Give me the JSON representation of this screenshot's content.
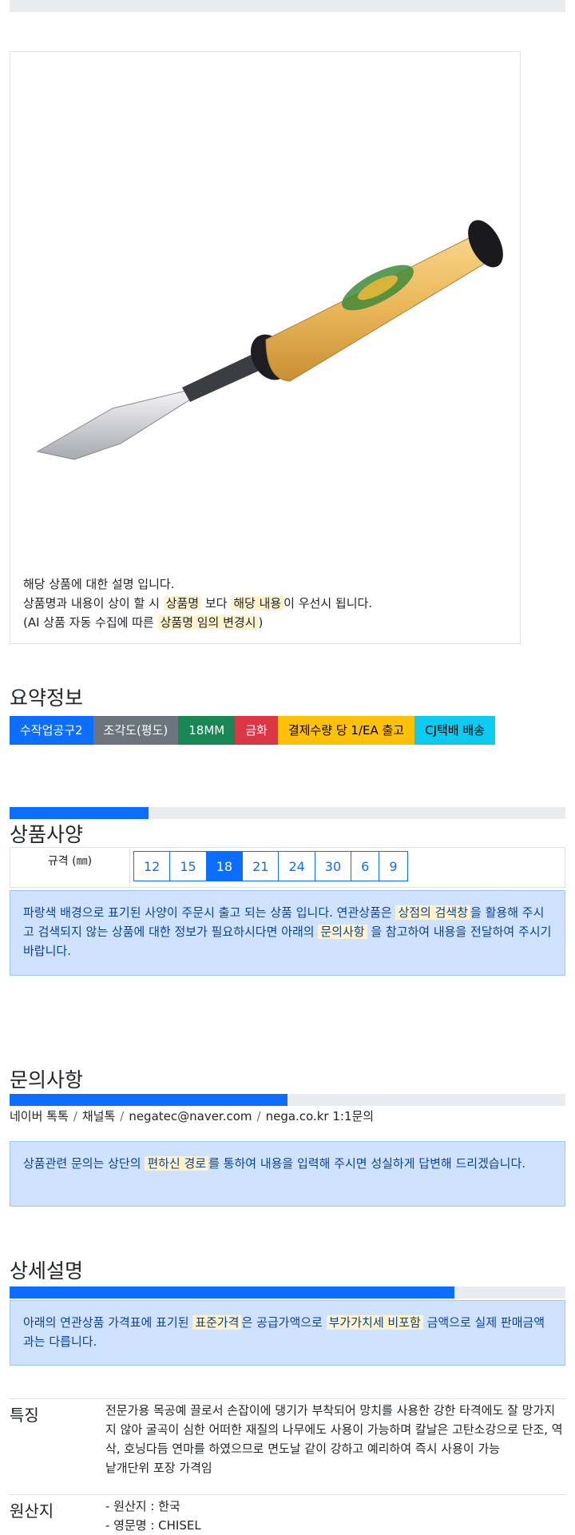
{
  "colors": {
    "primary": "#0d6efd",
    "secondary": "#6c757d",
    "success": "#198754",
    "danger": "#dc3545",
    "warning": "#ffc107",
    "info": "#0dcaf0",
    "highlight": "#fff3cd",
    "alert_bg": "#cfe2ff"
  },
  "product_image": {
    "icon": "chisel-image"
  },
  "description": {
    "line1": "해당 상품에 대한 설명 입니다.",
    "line2_a": "상품명과 내용이 상이 할 시 ",
    "line2_hl1": "상품명",
    "line2_b": " 보다 ",
    "line2_hl2": "해당 내용",
    "line2_c": "이 우선시 됩니다.",
    "line3_a": "(AI 상품 자동 수집에 따른 ",
    "line3_hl": "상품명 임의 변경시",
    "line3_b": ")"
  },
  "summary": {
    "title": "요약정보",
    "badges": [
      "수작업공구2",
      "조각도(평도)",
      "18MM",
      "금화",
      "결제수량 당 1/EA 출고",
      "CJ택배 배송"
    ]
  },
  "spec": {
    "title": "상품사양",
    "progress": 0.25,
    "label": "규격 (㎜)",
    "options": [
      "12",
      "15",
      "18",
      "21",
      "24",
      "30",
      "6",
      "9"
    ],
    "selected": "18",
    "notice_a": "파랑색 배경으로 표기된 사양이 주문시 출고 되는 상품 입니다. 연관상품은 ",
    "notice_hl1": "상점의 검색창",
    "notice_b": "을 활용해 주시고 검색되지 않는 상품에 대한 정보가 필요하시다면 아래의 ",
    "notice_hl2": "문의사항",
    "notice_c": " 을 참고하여 내용을 전달하여 주시기 바랍니다."
  },
  "inquiry": {
    "title": "문의사항",
    "progress": 0.5,
    "contacts": [
      "네이버 톡톡",
      "채널톡",
      "negatec@naver.com",
      "nega.co.kr 1:1문의"
    ],
    "separator": "/",
    "notice_a": "상품관련 문의는 상단의 ",
    "notice_hl": "편하신 경로",
    "notice_b": "를 통하여 내용을 입력해 주시면 성실하게 답변해 드리겠습니다."
  },
  "detail": {
    "title": "상세설명",
    "progress": 0.8,
    "notice_a": "아래의 연관상품 가격표에 표기된 ",
    "notice_hl1": "표준가격",
    "notice_b": "은 공급가액으로 ",
    "notice_hl2": "부가가치세 비포함",
    "notice_c": " 금액으로 실제 판매금액과는 다릅니다.",
    "rows": [
      {
        "label": "특징",
        "lines": [
          "전문가용 목공예 끌로서 손잡이에 댕기가 부착되어 망치를 사용한 강한 타격에도 잘 망가지지 않아 굴곡이 심한 어떠한 재질의 나무에도 사용이 가능하며 칼날은 고탄소강으로 단조, 역삭, 호닝다듬 연마를 하였으므로 면도날 같이 강하고 예리하여 즉시 사용이 가능",
          "낱개단위 포장 가격임"
        ]
      },
      {
        "label": "원산지",
        "lines": [
          "- 원산지 : 한국",
          "- 영문명 : CHISEL"
        ]
      }
    ]
  }
}
